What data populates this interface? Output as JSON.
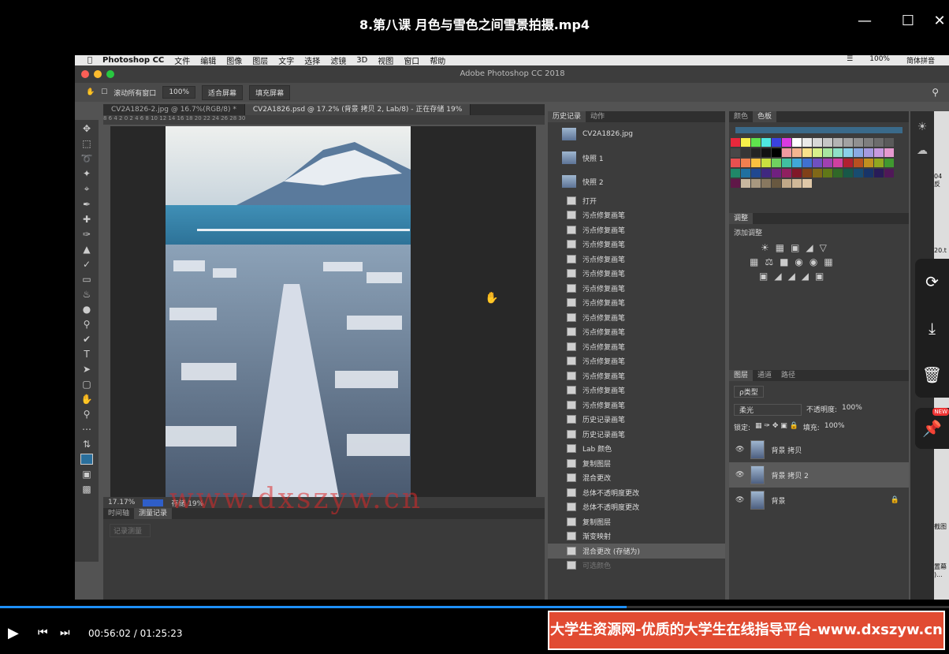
{
  "player": {
    "title": "8.第八课 月色与雪色之间雪景拍摄.mp4",
    "time_current": "00:56:02",
    "time_sep": " / ",
    "time_total": "01:25:23",
    "progress_fraction": 0.66,
    "banner": "大学生资源网-优质的大学生在线指导平台-www.dxszyw.cn",
    "watermark": "www.dxszyw.cn"
  },
  "mac": {
    "menu": [
      "Photoshop CC",
      "文件",
      "编辑",
      "图像",
      "图层",
      "文字",
      "选择",
      "滤镜",
      "3D",
      "视图",
      "窗口",
      "帮助"
    ],
    "status_right": [
      "100%",
      "简体拼音"
    ],
    "window_title": "Adobe Photoshop CC 2018"
  },
  "options": {
    "scroll_all": "滚动所有窗口",
    "zoom": "100%",
    "fit": "适合屏幕",
    "fill": "填充屏幕"
  },
  "doc_tabs": [
    "CV2A1826-2.jpg @ 16.7%(RGB/8) *",
    "CV2A1826.psd @ 17.2% (背景 拷贝 2, Lab/8) - 正在存储 19%"
  ],
  "ruler_text": "8 6 4 2 0 2 4 6 8 10 12 14 16 18 20 22 24 26 28 30",
  "status": {
    "zoom": "17.17%",
    "save": "存储 19%"
  },
  "bottom_panel": {
    "tabs": [
      "时间轴",
      "测量记录"
    ],
    "button": "记录测量"
  },
  "history": {
    "tabs": [
      "历史记录",
      "动作"
    ],
    "snapshots": [
      "CV2A1826.jpg",
      "快照 1",
      "快照 2"
    ],
    "items": [
      "打开",
      "污点修复画笔",
      "污点修复画笔",
      "污点修复画笔",
      "污点修复画笔",
      "污点修复画笔",
      "污点修复画笔",
      "污点修复画笔",
      "污点修复画笔",
      "污点修复画笔",
      "污点修复画笔",
      "污点修复画笔",
      "污点修复画笔",
      "污点修复画笔",
      "污点修复画笔",
      "历史记录画笔",
      "历史记录画笔",
      "Lab 颜色",
      "复制图层",
      "混合更改",
      "总体不透明度更改",
      "总体不透明度更改",
      "复制图层",
      "渐变映射",
      "混合更改 (存储为)",
      "可选颜色"
    ]
  },
  "color_panel": {
    "tabs": [
      "颜色",
      "色板"
    ]
  },
  "swatches": [
    "#e8283c",
    "#f7f04a",
    "#5fe34d",
    "#4ee8e0",
    "#3a42e0",
    "#d93ae0",
    "#ffffff",
    "#eaeaea",
    "#d8d8d8",
    "#c6c6c6",
    "#b4b4b4",
    "#a2a2a2",
    "#909090",
    "#7e7e7e",
    "#6c6c6c",
    "#5a5a5a",
    "#484848",
    "#363636",
    "#242424",
    "#121212",
    "#000000",
    "#ef9aa0",
    "#f4b590",
    "#f8e18a",
    "#d8f08a",
    "#a8e6a0",
    "#8fe0c8",
    "#8ad0ea",
    "#8aaae4",
    "#a59ae0",
    "#c89ae0",
    "#e69ad0",
    "#e85050",
    "#f08050",
    "#f8c040",
    "#c8e040",
    "#70d060",
    "#40c0a0",
    "#40a8d8",
    "#4070d0",
    "#7050c0",
    "#a040b0",
    "#d040a0",
    "#b02030",
    "#b85020",
    "#c09020",
    "#90a820",
    "#409830",
    "#208868",
    "#2070a0",
    "#204890",
    "#402880",
    "#702080",
    "#902060",
    "#801828",
    "#804018",
    "#806818",
    "#607818",
    "#306828",
    "#185848",
    "#184c70",
    "#183468",
    "#281c58",
    "#501858",
    "#601848",
    "#c8b8a0",
    "#a89880",
    "#887860",
    "#685840",
    "#c0a888",
    "#d0b898",
    "#e0c8a8"
  ],
  "adjust": {
    "title": "调整",
    "add": "添加调整"
  },
  "layers": {
    "tabs": [
      "图层",
      "通道",
      "路径"
    ],
    "kind": "ρ类型",
    "blend": "柔光",
    "opacity_label": "不透明度:",
    "opacity": "100%",
    "lock_label": "锁定:",
    "fill_label": "填充:",
    "fill": "100%",
    "items": [
      "背景 拷贝",
      "背景 拷贝 2",
      "背景"
    ]
  },
  "right_strip": [
    "04 反",
    "20.t",
    "截图",
    "置幕 )..."
  ],
  "float_new": "NEW"
}
